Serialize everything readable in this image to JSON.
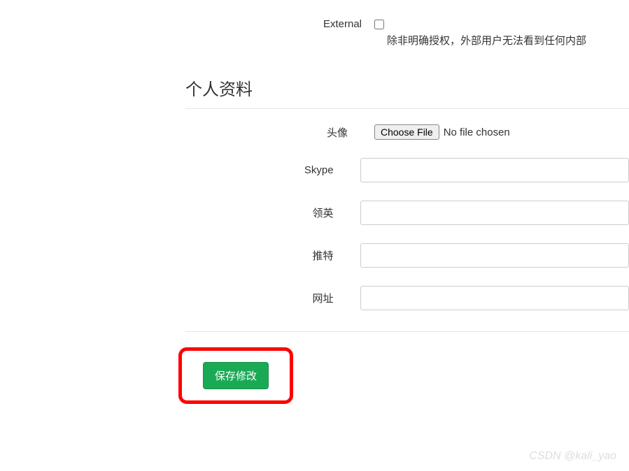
{
  "external": {
    "label": "External",
    "checked": false,
    "help_text": "除非明确授权，外部用户无法看到任何内部"
  },
  "profile_section": {
    "title": "个人资料",
    "avatar": {
      "label": "头像",
      "button": "Choose File",
      "status": "No file chosen"
    },
    "skype": {
      "label": "Skype",
      "value": ""
    },
    "linkedin": {
      "label": "领英",
      "value": ""
    },
    "twitter": {
      "label": "推特",
      "value": ""
    },
    "website": {
      "label": "网址",
      "value": ""
    }
  },
  "actions": {
    "save": "保存修改"
  },
  "watermark": "CSDN @kali_yao"
}
